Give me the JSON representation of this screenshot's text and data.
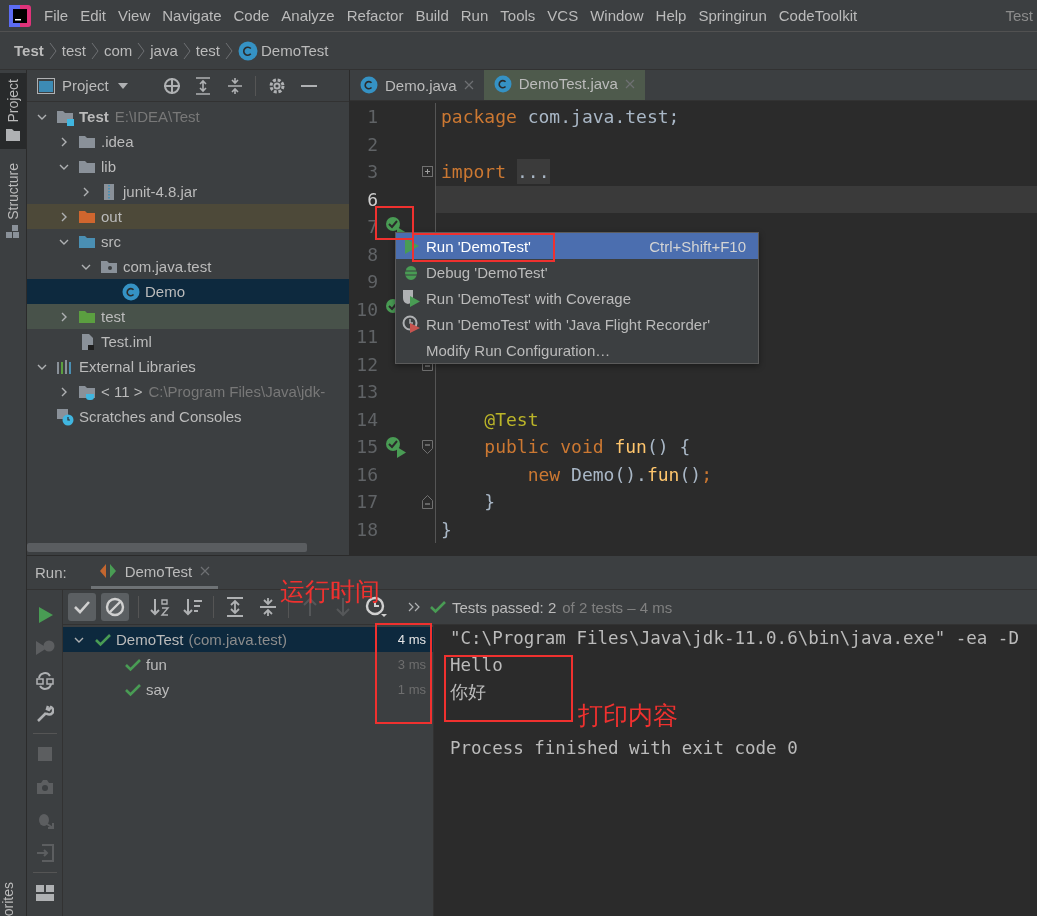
{
  "menu_bar": {
    "items": [
      "File",
      "Edit",
      "View",
      "Navigate",
      "Code",
      "Analyze",
      "Refactor",
      "Build",
      "Run",
      "Tools",
      "VCS",
      "Window",
      "Help",
      "Springirun",
      "CodeToolkit"
    ],
    "project": "Test"
  },
  "breadcrumb": [
    {
      "label": "Test",
      "kind": "project"
    },
    {
      "label": "test",
      "kind": "folder"
    },
    {
      "label": "com",
      "kind": "folder"
    },
    {
      "label": "java",
      "kind": "folder"
    },
    {
      "label": "test",
      "kind": "folder"
    },
    {
      "label": "DemoTest",
      "kind": "class"
    }
  ],
  "tool_strip": {
    "tabs": [
      {
        "label": "Project",
        "selected": true
      },
      {
        "label": "Structure",
        "selected": false
      }
    ],
    "bottom_tab": "orites"
  },
  "project_panel": {
    "title": "Project",
    "tree": [
      {
        "label": "Test",
        "detail": "E:\\IDEA\\Test",
        "kind": "project",
        "expanded": true,
        "selected": false,
        "children": [
          {
            "label": ".idea",
            "kind": "folder",
            "expanded": false,
            "selected": false
          },
          {
            "label": "lib",
            "kind": "folder",
            "expanded": true,
            "selected": false,
            "children": [
              {
                "label": "junit-4.8.jar",
                "kind": "jar",
                "expanded": false,
                "selected": false
              }
            ]
          },
          {
            "label": "out",
            "kind": "excluded",
            "expanded": false,
            "selected": false
          },
          {
            "label": "src",
            "kind": "source",
            "expanded": true,
            "selected": false,
            "children": [
              {
                "label": "com.java.test",
                "kind": "package",
                "expanded": true,
                "selected": false,
                "children": [
                  {
                    "label": "Demo",
                    "kind": "class",
                    "selected": true
                  }
                ]
              }
            ]
          },
          {
            "label": "test",
            "kind": "test",
            "expanded": false,
            "selected": false
          },
          {
            "label": "Test.iml",
            "kind": "file",
            "selected": false
          }
        ]
      },
      {
        "label": "External Libraries",
        "kind": "libraries",
        "expanded": true,
        "selected": false,
        "children": [
          {
            "label": "< 11 >",
            "detail": "C:\\Program Files\\Java\\jdk-",
            "kind": "sdk",
            "expanded": false,
            "selected": false
          }
        ]
      },
      {
        "label": "Scratches and Consoles",
        "kind": "scratches",
        "selected": false
      }
    ]
  },
  "editor": {
    "tabs": [
      {
        "label": "Demo.java",
        "selected": false
      },
      {
        "label": "DemoTest.java",
        "selected": true
      }
    ],
    "lines": [
      {
        "number": "1",
        "current": false,
        "tokens": [
          {
            "kind": "keyword",
            "text": "package"
          },
          {
            "kind": "plain",
            "text": " com.java.test;"
          }
        ]
      },
      {
        "number": "2",
        "current": false
      },
      {
        "number": "3",
        "current": false,
        "folded": true,
        "tokens": [
          {
            "kind": "keyword",
            "text": "import"
          },
          {
            "kind": "folded",
            "text": "..."
          }
        ]
      },
      {
        "number": "6",
        "current": true
      },
      {
        "number": "7",
        "current": false,
        "runnable": true
      },
      {
        "number": "8",
        "current": false
      },
      {
        "number": "9",
        "current": false
      },
      {
        "number": "10",
        "current": false,
        "runnable": true
      },
      {
        "number": "11",
        "current": false
      },
      {
        "number": "12",
        "current": false,
        "fold_end": true
      },
      {
        "number": "13",
        "current": false
      },
      {
        "number": "14",
        "current": false,
        "tokens": [
          {
            "kind": "annotation",
            "text": "    @Test"
          }
        ]
      },
      {
        "number": "15",
        "current": false,
        "runnable": true,
        "fold_start": true,
        "tokens": [
          {
            "kind": "keyword",
            "text": "    public void "
          },
          {
            "kind": "method",
            "text": "fun"
          },
          {
            "kind": "plain",
            "text": "() {"
          }
        ]
      },
      {
        "number": "16",
        "current": false,
        "tokens": [
          {
            "kind": "keyword",
            "text": "        new"
          },
          {
            "kind": "plain",
            "text": " Demo()."
          },
          {
            "kind": "method",
            "text": "fun"
          },
          {
            "kind": "plain",
            "text": "()"
          },
          {
            "kind": "keyword",
            "text": ";"
          }
        ]
      },
      {
        "number": "17",
        "current": false,
        "fold_end": true,
        "tokens": [
          {
            "kind": "plain",
            "text": "    }"
          }
        ]
      },
      {
        "number": "18",
        "current": false,
        "tokens": [
          {
            "kind": "plain",
            "text": "}"
          }
        ]
      }
    ],
    "popup": {
      "items": [
        {
          "kind": "run",
          "label": "Run 'DemoTest'",
          "shortcut": "Ctrl+Shift+F10",
          "selected": true
        },
        {
          "kind": "debug",
          "label": "Debug 'DemoTest'",
          "selected": false
        },
        {
          "kind": "coverage",
          "label": "Run 'DemoTest' with Coverage",
          "selected": false
        },
        {
          "kind": "profiler",
          "label": "Run 'DemoTest' with 'Java Flight Recorder'",
          "selected": false
        },
        {
          "kind": "configure",
          "label": "Modify Run Configuration…",
          "selected": false
        }
      ]
    }
  },
  "run_panel": {
    "label": "Run:",
    "tab": {
      "label": "DemoTest",
      "selected": true
    },
    "side_actions": [
      {
        "kind": "run",
        "disabled": false
      },
      {
        "kind": "rerun-failed",
        "disabled": true
      },
      {
        "kind": "auto-test",
        "disabled": false
      },
      {
        "kind": "settings",
        "disabled": false
      },
      {
        "kind": "stop",
        "disabled": true
      },
      {
        "kind": "snapshot",
        "disabled": true
      },
      {
        "kind": "export",
        "disabled": true
      },
      {
        "kind": "exit",
        "disabled": true
      },
      {
        "kind": "layout",
        "disabled": false
      }
    ],
    "toggles": [
      {
        "kind": "passed",
        "on": true
      },
      {
        "kind": "ignored",
        "on": true
      }
    ],
    "navigation": [
      {
        "kind": "up",
        "disabled": true
      },
      {
        "kind": "down",
        "disabled": true
      }
    ],
    "status": {
      "main": "Tests passed: 2",
      "detail": "of 2 tests – 4 ms"
    },
    "tests": [
      {
        "label": "DemoTest",
        "detail": "(com.java.test)",
        "time": "4 ms",
        "expanded": true,
        "selected": true,
        "children": [
          {
            "label": "fun",
            "time": "3 ms",
            "selected": false
          },
          {
            "label": "say",
            "time": "1 ms",
            "selected": false
          }
        ]
      }
    ],
    "console_blocks": [
      [
        "\"C:\\Program Files\\Java\\jdk-11.0.6\\bin\\java.exe\" -ea -D",
        "Hello",
        "你好"
      ],
      [
        "Process finished with exit code 0"
      ]
    ]
  },
  "annotations": {
    "labels": [
      "运行时间",
      "打印内容"
    ]
  }
}
